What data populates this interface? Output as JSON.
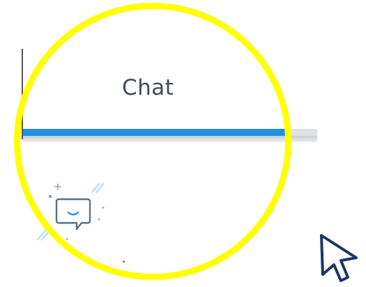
{
  "tabs": [
    {
      "label": "Chat",
      "active": true
    }
  ],
  "icons": {
    "chat": "chat-bubble-smile-icon",
    "cursor": "mouse-pointer-icon"
  },
  "colors": {
    "active_tab_underline": "#1e90df",
    "highlight_ring": "#ffff00",
    "tab_text": "#404b57"
  }
}
